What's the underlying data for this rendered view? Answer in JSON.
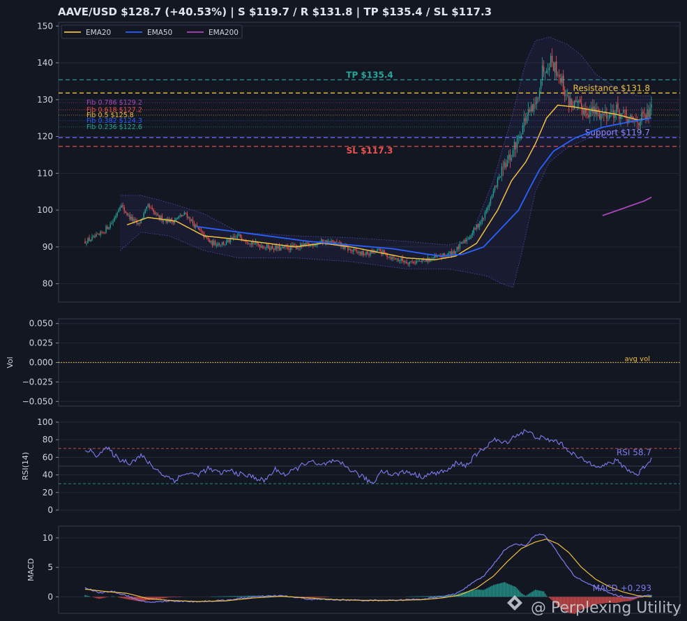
{
  "header": {
    "title": "AAVE/USD   $128.7  (+40.53%)  |  S $119.7 / R $131.8  |  TP $135.4 / SL $117.3"
  },
  "watermark": {
    "text": "@ Perplexing Utility"
  },
  "colors": {
    "bg": "#131722",
    "panel": "#131722",
    "grid": "#222837",
    "axis": "#363c4e",
    "up": "#26a69a",
    "down": "#ef5350",
    "ema20": "#f0c040",
    "ema50": "#2962ff",
    "ema200": "#ab47bc",
    "rsi": "#7e7cf0",
    "tp": "#26a69a",
    "sl": "#ef5350",
    "support": "#6c63ff",
    "resistance": "#f0c040",
    "avgvol": "#f0c040",
    "macdSignal": "#f0c040"
  },
  "chart_data": [
    {
      "type": "candlestick",
      "panel": "price",
      "ylim": [
        75,
        151
      ],
      "yticks": [
        80,
        90,
        100,
        110,
        120,
        130,
        140,
        150
      ],
      "grid": true,
      "legend_placement": "top-left",
      "legend": [
        "EMA20",
        "EMA50",
        "EMA200"
      ],
      "levels": [
        {
          "name": "tp",
          "label": "TP $135.4",
          "value": 135.4,
          "color": "#26a69a"
        },
        {
          "name": "resistance",
          "label": "Resistance $131.8",
          "value": 131.8,
          "color": "#f0c040"
        },
        {
          "name": "support",
          "label": "Support $119.7",
          "value": 119.7,
          "color": "#6c63ff"
        },
        {
          "name": "sl",
          "label": "SL $117.3",
          "value": 117.3,
          "color": "#ef5350"
        }
      ],
      "fib": [
        {
          "label": "Fib 0.786 $129.2",
          "value": 129.2,
          "color": "#ab47bc"
        },
        {
          "label": "Fib 0.618 $127.2",
          "value": 127.2,
          "color": "#ef5350"
        },
        {
          "label": "Fib 0.5 $125.8",
          "value": 125.8,
          "color": "#f0c040"
        },
        {
          "label": "Fib 0.382 $124.3",
          "value": 124.3,
          "color": "#2962ff"
        },
        {
          "label": "Fib 0.236 $122.6",
          "value": 122.6,
          "color": "#26a69a"
        }
      ],
      "price_keypoints": [
        [
          0,
          91.5
        ],
        [
          10,
          93
        ],
        [
          20,
          97
        ],
        [
          25,
          101.5
        ],
        [
          32,
          98
        ],
        [
          38,
          96
        ],
        [
          45,
          101
        ],
        [
          52,
          98
        ],
        [
          62,
          97
        ],
        [
          72,
          99
        ],
        [
          80,
          95
        ],
        [
          90,
          91
        ],
        [
          100,
          91
        ],
        [
          110,
          93
        ],
        [
          120,
          91
        ],
        [
          130,
          90
        ],
        [
          140,
          89.5
        ],
        [
          150,
          90
        ],
        [
          160,
          90.5
        ],
        [
          170,
          91.5
        ],
        [
          180,
          91
        ],
        [
          190,
          89
        ],
        [
          200,
          88
        ],
        [
          210,
          89
        ],
        [
          220,
          87
        ],
        [
          230,
          86
        ],
        [
          240,
          86
        ],
        [
          250,
          87
        ],
        [
          260,
          88
        ],
        [
          265,
          89
        ],
        [
          275,
          93
        ],
        [
          285,
          98
        ],
        [
          295,
          108
        ],
        [
          305,
          115
        ],
        [
          310,
          120
        ],
        [
          315,
          125
        ],
        [
          322,
          128
        ],
        [
          327,
          138
        ],
        [
          333,
          141
        ],
        [
          340,
          136
        ],
        [
          345,
          130
        ],
        [
          352,
          128
        ],
        [
          360,
          127
        ],
        [
          370,
          126
        ],
        [
          380,
          127
        ],
        [
          390,
          124
        ],
        [
          400,
          125
        ],
        [
          405,
          127
        ]
      ],
      "ema20_keypoints": [
        [
          30,
          96
        ],
        [
          45,
          98
        ],
        [
          65,
          97
        ],
        [
          85,
          93
        ],
        [
          110,
          92
        ],
        [
          150,
          90
        ],
        [
          170,
          91
        ],
        [
          190,
          90
        ],
        [
          210,
          88.5
        ],
        [
          230,
          87
        ],
        [
          250,
          86.5
        ],
        [
          265,
          87.5
        ],
        [
          280,
          91
        ],
        [
          295,
          100
        ],
        [
          305,
          108
        ],
        [
          315,
          113
        ],
        [
          322,
          118
        ],
        [
          330,
          125
        ],
        [
          338,
          128.5
        ],
        [
          350,
          128
        ],
        [
          365,
          127
        ],
        [
          380,
          126
        ],
        [
          395,
          124.5
        ],
        [
          405,
          125
        ]
      ],
      "ema50_keypoints": [
        [
          80,
          95.5
        ],
        [
          100,
          94.5
        ],
        [
          130,
          93
        ],
        [
          160,
          91.5
        ],
        [
          190,
          90.5
        ],
        [
          220,
          89.5
        ],
        [
          245,
          88
        ],
        [
          255,
          87.5
        ],
        [
          270,
          88
        ],
        [
          285,
          90
        ],
        [
          300,
          96
        ],
        [
          310,
          100
        ],
        [
          318,
          106
        ],
        [
          325,
          111
        ],
        [
          335,
          116
        ],
        [
          350,
          119.5
        ],
        [
          370,
          122.5
        ],
        [
          390,
          124
        ],
        [
          405,
          125
        ]
      ],
      "ema200_keypoints": [
        [
          370,
          98.5
        ],
        [
          385,
          100.5
        ],
        [
          400,
          102.5
        ],
        [
          405,
          103.5
        ]
      ],
      "bb_upper_keypoints": [
        [
          25,
          104
        ],
        [
          40,
          104
        ],
        [
          60,
          102
        ],
        [
          85,
          99
        ],
        [
          110,
          94
        ],
        [
          150,
          93
        ],
        [
          190,
          92.5
        ],
        [
          230,
          91.5
        ],
        [
          260,
          90.5
        ],
        [
          275,
          92
        ],
        [
          292,
          108
        ],
        [
          305,
          125
        ],
        [
          315,
          140
        ],
        [
          322,
          146
        ],
        [
          332,
          147
        ],
        [
          345,
          145
        ],
        [
          355,
          142
        ],
        [
          365,
          137
        ],
        [
          380,
          133
        ],
        [
          395,
          131
        ],
        [
          405,
          131
        ]
      ],
      "bb_lower_keypoints": [
        [
          25,
          89
        ],
        [
          40,
          94
        ],
        [
          60,
          93
        ],
        [
          85,
          89
        ],
        [
          110,
          87
        ],
        [
          150,
          87
        ],
        [
          190,
          86
        ],
        [
          230,
          84
        ],
        [
          260,
          84
        ],
        [
          275,
          83
        ],
        [
          288,
          82
        ],
        [
          298,
          80
        ],
        [
          306,
          79
        ],
        [
          312,
          88
        ],
        [
          322,
          105
        ],
        [
          332,
          113
        ],
        [
          345,
          117
        ],
        [
          360,
          119.5
        ],
        [
          380,
          121
        ],
        [
          395,
          122
        ],
        [
          405,
          123
        ]
      ]
    },
    {
      "type": "bar",
      "panel": "volume",
      "ylabel": "Vol",
      "ylim": [
        -0.056,
        0.056
      ],
      "yticks": [
        -0.05,
        -0.025,
        0.0,
        0.025,
        0.05
      ],
      "avg_label": "avg vol",
      "avg_value": 0.0
    },
    {
      "type": "line",
      "panel": "rsi",
      "ylabel": "RSI(14)",
      "ylim": [
        0,
        100
      ],
      "yticks": [
        0,
        20,
        40,
        60,
        80,
        100
      ],
      "overbought": 70,
      "oversold": 30,
      "label": "RSI 58.7",
      "keypoints": [
        [
          0,
          70
        ],
        [
          8,
          63
        ],
        [
          16,
          70
        ],
        [
          24,
          58
        ],
        [
          32,
          54
        ],
        [
          40,
          62
        ],
        [
          48,
          50
        ],
        [
          56,
          40
        ],
        [
          64,
          34
        ],
        [
          72,
          42
        ],
        [
          80,
          40
        ],
        [
          88,
          47
        ],
        [
          96,
          42
        ],
        [
          104,
          45
        ],
        [
          112,
          40
        ],
        [
          120,
          38
        ],
        [
          128,
          33
        ],
        [
          136,
          46
        ],
        [
          144,
          40
        ],
        [
          152,
          48
        ],
        [
          160,
          56
        ],
        [
          168,
          50
        ],
        [
          176,
          55
        ],
        [
          184,
          52
        ],
        [
          192,
          44
        ],
        [
          200,
          36
        ],
        [
          206,
          30
        ],
        [
          212,
          46
        ],
        [
          220,
          40
        ],
        [
          230,
          44
        ],
        [
          240,
          38
        ],
        [
          250,
          42
        ],
        [
          260,
          45
        ],
        [
          266,
          55
        ],
        [
          272,
          50
        ],
        [
          278,
          60
        ],
        [
          285,
          70
        ],
        [
          292,
          80
        ],
        [
          300,
          76
        ],
        [
          308,
          85
        ],
        [
          315,
          90
        ],
        [
          322,
          84
        ],
        [
          330,
          80
        ],
        [
          338,
          78
        ],
        [
          346,
          68
        ],
        [
          352,
          60
        ],
        [
          360,
          54
        ],
        [
          370,
          50
        ],
        [
          380,
          56
        ],
        [
          390,
          44
        ],
        [
          395,
          40
        ],
        [
          400,
          50
        ],
        [
          405,
          58
        ]
      ]
    },
    {
      "type": "line",
      "panel": "macd",
      "ylabel": "MACD",
      "ylim": [
        -2.8,
        12
      ],
      "yticks": [
        0,
        5,
        10
      ],
      "label": "MACD +0.293",
      "macd_keypoints": [
        [
          0,
          1.6
        ],
        [
          10,
          0.7
        ],
        [
          20,
          0.9
        ],
        [
          30,
          0.2
        ],
        [
          40,
          -0.8
        ],
        [
          50,
          -0.9
        ],
        [
          60,
          -0.7
        ],
        [
          80,
          -0.8
        ],
        [
          100,
          -0.6
        ],
        [
          120,
          0.0
        ],
        [
          140,
          0.2
        ],
        [
          160,
          -0.4
        ],
        [
          180,
          -0.5
        ],
        [
          200,
          -0.6
        ],
        [
          220,
          -0.6
        ],
        [
          240,
          -0.4
        ],
        [
          255,
          0.0
        ],
        [
          265,
          0.5
        ],
        [
          275,
          2.0
        ],
        [
          285,
          3.5
        ],
        [
          292,
          5.5
        ],
        [
          300,
          8.0
        ],
        [
          308,
          9.0
        ],
        [
          315,
          8.7
        ],
        [
          322,
          10.5
        ],
        [
          328,
          10.6
        ],
        [
          335,
          8.5
        ],
        [
          342,
          6.0
        ],
        [
          350,
          3.5
        ],
        [
          360,
          2.2
        ],
        [
          370,
          1.2
        ],
        [
          380,
          0.2
        ],
        [
          390,
          -0.2
        ],
        [
          400,
          0.1
        ],
        [
          405,
          0.3
        ]
      ],
      "signal_keypoints": [
        [
          0,
          1.3
        ],
        [
          15,
          0.9
        ],
        [
          30,
          0.6
        ],
        [
          45,
          -0.3
        ],
        [
          60,
          -0.6
        ],
        [
          80,
          -0.8
        ],
        [
          100,
          -0.7
        ],
        [
          120,
          -0.2
        ],
        [
          140,
          0.1
        ],
        [
          160,
          -0.2
        ],
        [
          180,
          -0.5
        ],
        [
          200,
          -0.6
        ],
        [
          220,
          -0.6
        ],
        [
          240,
          -0.5
        ],
        [
          255,
          -0.2
        ],
        [
          268,
          0.3
        ],
        [
          280,
          1.5
        ],
        [
          292,
          3.5
        ],
        [
          302,
          6.0
        ],
        [
          312,
          8.2
        ],
        [
          322,
          9.3
        ],
        [
          330,
          9.8
        ],
        [
          338,
          9.0
        ],
        [
          346,
          7.5
        ],
        [
          355,
          5.0
        ],
        [
          365,
          3.0
        ],
        [
          375,
          1.7
        ],
        [
          385,
          0.8
        ],
        [
          395,
          0.2
        ],
        [
          405,
          0.0
        ]
      ]
    }
  ]
}
